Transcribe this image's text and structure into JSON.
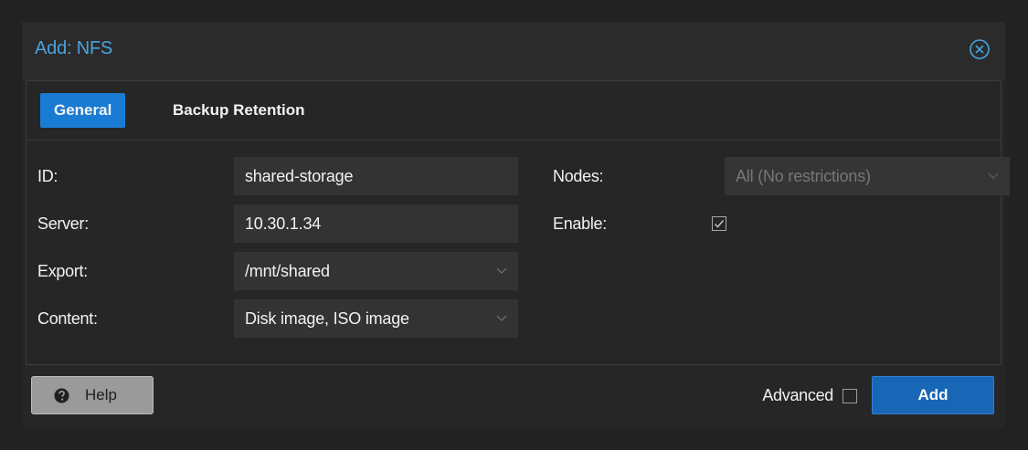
{
  "dialog": {
    "title": "Add: NFS",
    "close_icon": "close-circle-icon"
  },
  "tabs": [
    {
      "label": "General",
      "active": true
    },
    {
      "label": "Backup Retention",
      "active": false
    }
  ],
  "form": {
    "id": {
      "label": "ID:",
      "value": "shared-storage"
    },
    "server": {
      "label": "Server:",
      "value": "10.30.1.34"
    },
    "export": {
      "label": "Export:",
      "value": "/mnt/shared"
    },
    "content": {
      "label": "Content:",
      "value": "Disk image, ISO image"
    },
    "nodes": {
      "label": "Nodes:",
      "value": "All (No restrictions)",
      "disabled": true
    },
    "enable": {
      "label": "Enable:",
      "checked": true
    }
  },
  "footer": {
    "help_label": "Help",
    "help_icon": "question-circle-icon",
    "advanced_label": "Advanced",
    "advanced_checked": false,
    "add_label": "Add"
  },
  "colors": {
    "accent": "#1a7bd3",
    "title": "#4aa3df",
    "primary_button": "#1866b6"
  }
}
